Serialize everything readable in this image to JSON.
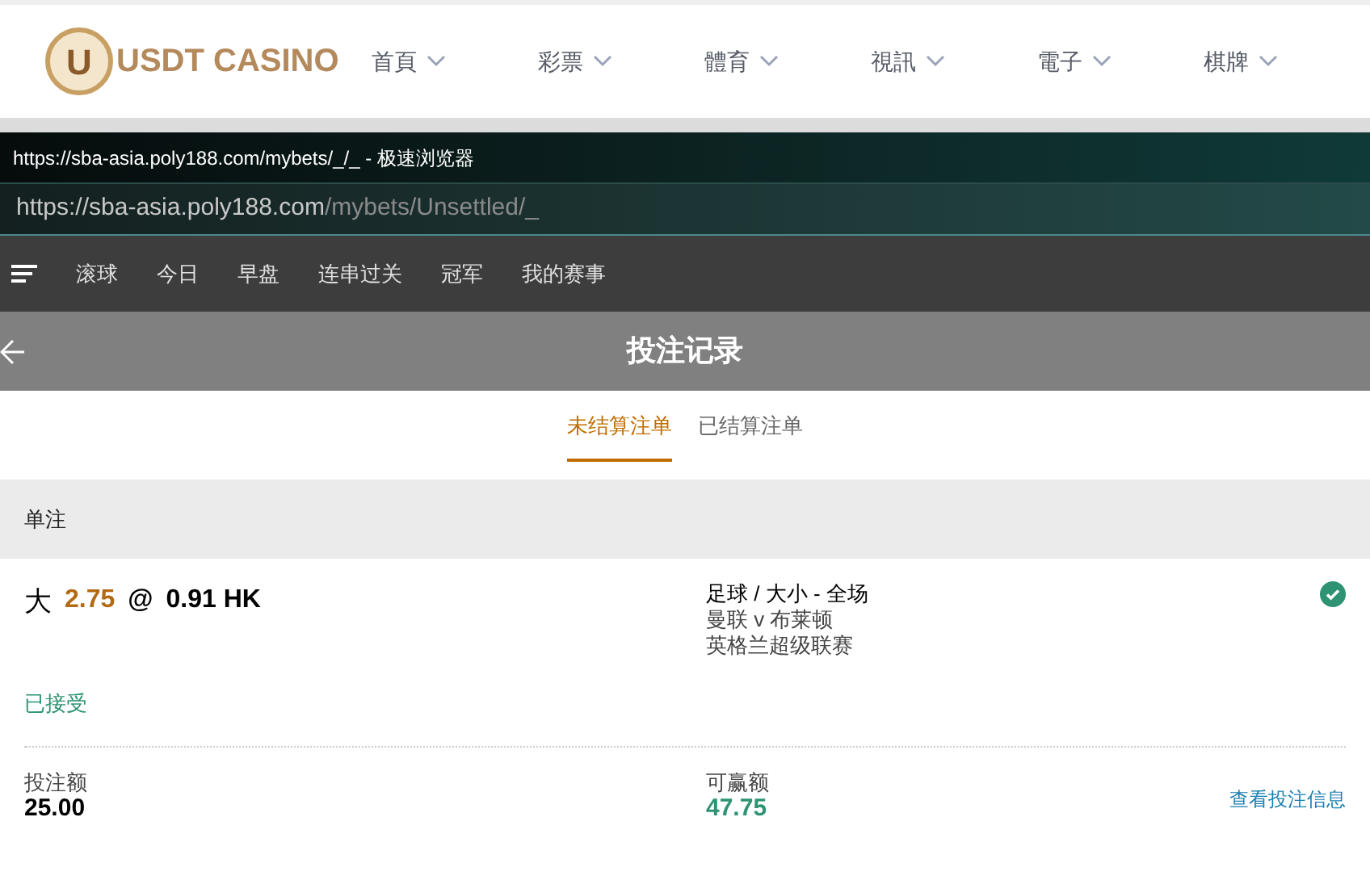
{
  "site_header": {
    "logo_mark": "U",
    "logo_text": "USDT CASINO",
    "menu": [
      {
        "label": "首頁"
      },
      {
        "label": "彩票"
      },
      {
        "label": "體育"
      },
      {
        "label": "視訊"
      },
      {
        "label": "電子"
      },
      {
        "label": "棋牌"
      }
    ]
  },
  "browser": {
    "title": "https://sba-asia.poly188.com/mybets/_/_ - 极速浏览器",
    "url_host": "https://sba-asia.poly188.com",
    "url_path": "/mybets/Unsettled/_"
  },
  "nav": {
    "items": [
      "滚球",
      "今日",
      "早盘",
      "连串过关",
      "冠军",
      "我的赛事"
    ]
  },
  "page_title": "投注记录",
  "tabs": [
    {
      "label": "未结算注单",
      "selected": true
    },
    {
      "label": "已结算注单",
      "selected": false
    }
  ],
  "section": "单注",
  "bet": {
    "selection": "大",
    "line": "2.75",
    "at": "@",
    "odds": "0.91 HK",
    "market": "足球 / 大小 - 全场",
    "match": "曼联 v 布莱顿",
    "league": "英格兰超级联赛",
    "status": "已接受",
    "accepted": true,
    "stake_label": "投注额",
    "stake": "25.00",
    "win_label": "可赢额",
    "win": "47.75",
    "details_link": "查看投注信息"
  }
}
